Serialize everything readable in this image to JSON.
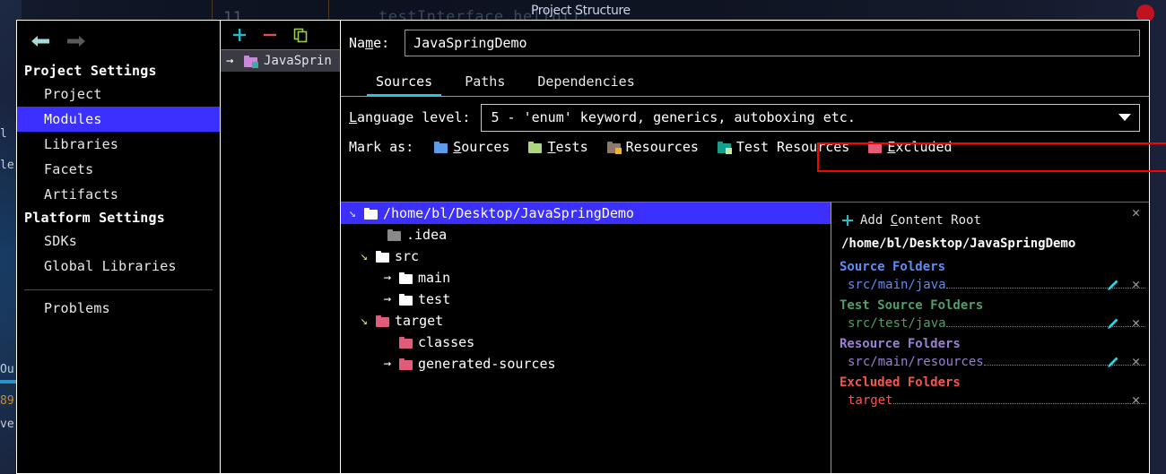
{
  "window": {
    "dialog_title": "Project Structure",
    "close_icon": "close-dot-icon"
  },
  "background": {
    "line_number": "11",
    "code_fragment": "testInterface.hello();",
    "left_fragments": [
      "le",
      "Ou",
      "89",
      "ve",
      "l"
    ]
  },
  "nav": {
    "back_icon": "back-arrow-icon",
    "forward_icon": "forward-arrow-icon",
    "groups": [
      {
        "title": "Project Settings",
        "items": [
          {
            "label": "Project",
            "selected": false
          },
          {
            "label": "Modules",
            "selected": true
          },
          {
            "label": "Libraries",
            "selected": false
          },
          {
            "label": "Facets",
            "selected": false
          },
          {
            "label": "Artifacts",
            "selected": false
          }
        ]
      },
      {
        "title": "Platform Settings",
        "items": [
          {
            "label": "SDKs",
            "selected": false
          },
          {
            "label": "Global Libraries",
            "selected": false
          }
        ]
      }
    ],
    "footer_item": "Problems"
  },
  "modules": {
    "add_icon": "plus-icon",
    "remove_icon": "minus-icon",
    "copy_icon": "copy-icon",
    "rows": [
      {
        "expand_icon": "chevron-right-icon",
        "label": "JavaSprin",
        "selected": true
      }
    ]
  },
  "form": {
    "name_label_pre": "Na",
    "name_label_mnemonic": "m",
    "name_label_post": "e:",
    "name_value": "JavaSpringDemo",
    "tabs": [
      {
        "label": "Sources",
        "active": true
      },
      {
        "label": "Paths",
        "active": false
      },
      {
        "label": "Dependencies",
        "active": false
      }
    ],
    "language_level_label_mnemonic": "L",
    "language_level_label_rest": "anguage level:",
    "language_level_value": "5 - 'enum' keyword, generics, autoboxing etc.",
    "dropdown_caret_icon": "chevron-down-icon",
    "highlight_color": "#ff0000",
    "mark_as_label": "Mark as:",
    "mark_as": [
      {
        "label_mnemonic": "S",
        "label_rest": "ources",
        "icon": "folder-blue-icon",
        "color": "#5d9ae8"
      },
      {
        "label_mnemonic": "T",
        "label_rest": "ests",
        "icon": "folder-green-icon",
        "color": "#aed581"
      },
      {
        "label_mnemonic": "",
        "label_rest": "Resources",
        "icon": "folder-brown-icon",
        "color": "#8d7a6d",
        "badge": "#f0b429"
      },
      {
        "label_mnemonic": "",
        "label_rest": "Test Resources",
        "icon": "folder-teal-icon",
        "color": "#13a08a",
        "badge": "#cfe8a0"
      },
      {
        "label_mnemonic": "E",
        "label_rest": "xcluded",
        "icon": "folder-pink-icon",
        "color": "#e05c78"
      }
    ]
  },
  "tree": {
    "nodes": [
      {
        "indent": 0,
        "twisty": "expanded",
        "label": "/home/bl/Desktop/JavaSpringDemo",
        "icon_color": "#ffffff",
        "selected": true
      },
      {
        "indent": 1,
        "twisty": "none",
        "label": ".idea",
        "icon_color": "#8a8a8a",
        "selected": false
      },
      {
        "indent": 1,
        "twisty": "expanded",
        "label": "src",
        "icon_color": "#ffffff",
        "selected": false
      },
      {
        "indent": 2,
        "twisty": "collapsed",
        "label": "main",
        "icon_color": "#ffffff",
        "selected": false
      },
      {
        "indent": 2,
        "twisty": "collapsed",
        "label": "test",
        "icon_color": "#ffffff",
        "selected": false
      },
      {
        "indent": 1,
        "twisty": "expanded",
        "label": "target",
        "icon_color": "#e05c78",
        "selected": false
      },
      {
        "indent": 2,
        "twisty": "none",
        "label": "classes",
        "icon_color": "#e05c78",
        "selected": false
      },
      {
        "indent": 2,
        "twisty": "collapsed",
        "label": "generated-sources",
        "icon_color": "#e05c78",
        "selected": false
      }
    ]
  },
  "detail": {
    "add_content_root_pre": "Add ",
    "add_content_root_mnemonic": "C",
    "add_content_root_post": "ontent Root",
    "add_icon": "plus-icon",
    "content_root": "/home/bl/Desktop/JavaSpringDemo",
    "sections": [
      {
        "title": "Source Folders",
        "color": "#5d8df5",
        "entries": [
          {
            "path": "src/main/java",
            "color": "#5d8df5",
            "has_pencil": true,
            "has_close": true
          }
        ]
      },
      {
        "title": "Test Source Folders",
        "color": "#4f9f6b",
        "entries": [
          {
            "path": "src/test/java",
            "color": "#4f9f6b",
            "has_pencil": true,
            "has_close": true
          }
        ]
      },
      {
        "title": "Resource Folders",
        "color": "#9b7fd4",
        "entries": [
          {
            "path": "src/main/resources",
            "color": "#9b7fd4",
            "has_pencil": true,
            "has_close": true
          }
        ]
      },
      {
        "title": "Excluded Folders",
        "color": "#f2564d",
        "entries": [
          {
            "path": "target",
            "color": "#f2564d",
            "has_pencil": false,
            "has_close": true
          }
        ]
      }
    ],
    "pencil_icon": "pencil-icon",
    "close_icon": "close-x-icon"
  }
}
